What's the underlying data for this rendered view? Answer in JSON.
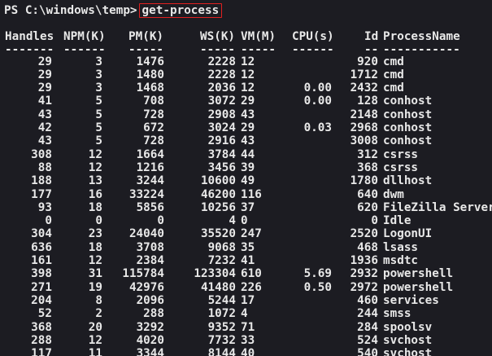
{
  "prompt": {
    "text": "PS C:\\windows\\temp>",
    "command": "get-process"
  },
  "table": {
    "headers": {
      "handles": "Handles",
      "npm": "NPM(K)",
      "pm": "PM(K)",
      "ws": "WS(K)",
      "vm": "VM(M)",
      "cpu": "CPU(s)",
      "id": "Id",
      "name": "ProcessName"
    },
    "underlines": {
      "handles": "-------",
      "npm": "------",
      "pm": "-----",
      "ws": "-----",
      "vm": "-----",
      "cpu": "------",
      "id": "--",
      "name": "-----------"
    },
    "rows": [
      {
        "handles": "29",
        "npm": "3",
        "pm": "1476",
        "ws": "2228",
        "vm": "12",
        "cpu": "",
        "id": "920",
        "name": "cmd"
      },
      {
        "handles": "29",
        "npm": "3",
        "pm": "1480",
        "ws": "2228",
        "vm": "12",
        "cpu": "",
        "id": "1712",
        "name": "cmd"
      },
      {
        "handles": "29",
        "npm": "3",
        "pm": "1468",
        "ws": "2036",
        "vm": "12",
        "cpu": "0.00",
        "id": "2432",
        "name": "cmd"
      },
      {
        "handles": "41",
        "npm": "5",
        "pm": "708",
        "ws": "3072",
        "vm": "29",
        "cpu": "0.00",
        "id": "128",
        "name": "conhost"
      },
      {
        "handles": "43",
        "npm": "5",
        "pm": "728",
        "ws": "2908",
        "vm": "43",
        "cpu": "",
        "id": "2148",
        "name": "conhost"
      },
      {
        "handles": "42",
        "npm": "5",
        "pm": "672",
        "ws": "3024",
        "vm": "29",
        "cpu": "0.03",
        "id": "2968",
        "name": "conhost"
      },
      {
        "handles": "43",
        "npm": "5",
        "pm": "728",
        "ws": "2916",
        "vm": "43",
        "cpu": "",
        "id": "3008",
        "name": "conhost"
      },
      {
        "handles": "308",
        "npm": "12",
        "pm": "1664",
        "ws": "3784",
        "vm": "44",
        "cpu": "",
        "id": "312",
        "name": "csrss"
      },
      {
        "handles": "88",
        "npm": "12",
        "pm": "1216",
        "ws": "3456",
        "vm": "39",
        "cpu": "",
        "id": "368",
        "name": "csrss"
      },
      {
        "handles": "188",
        "npm": "13",
        "pm": "3244",
        "ws": "10600",
        "vm": "49",
        "cpu": "",
        "id": "1780",
        "name": "dllhost"
      },
      {
        "handles": "177",
        "npm": "16",
        "pm": "33224",
        "ws": "46200",
        "vm": "116",
        "cpu": "",
        "id": "640",
        "name": "dwm"
      },
      {
        "handles": "93",
        "npm": "18",
        "pm": "5856",
        "ws": "10256",
        "vm": "37",
        "cpu": "",
        "id": "620",
        "name": "FileZilla Server"
      },
      {
        "handles": "0",
        "npm": "0",
        "pm": "0",
        "ws": "4",
        "vm": "0",
        "cpu": "",
        "id": "0",
        "name": "Idle"
      },
      {
        "handles": "304",
        "npm": "23",
        "pm": "24040",
        "ws": "35520",
        "vm": "247",
        "cpu": "",
        "id": "2520",
        "name": "LogonUI"
      },
      {
        "handles": "636",
        "npm": "18",
        "pm": "3708",
        "ws": "9068",
        "vm": "35",
        "cpu": "",
        "id": "468",
        "name": "lsass"
      },
      {
        "handles": "161",
        "npm": "12",
        "pm": "2384",
        "ws": "7232",
        "vm": "41",
        "cpu": "",
        "id": "1936",
        "name": "msdtc"
      },
      {
        "handles": "398",
        "npm": "31",
        "pm": "115784",
        "ws": "123304",
        "vm": "610",
        "cpu": "5.69",
        "id": "2932",
        "name": "powershell"
      },
      {
        "handles": "271",
        "npm": "19",
        "pm": "42976",
        "ws": "41480",
        "vm": "226",
        "cpu": "0.50",
        "id": "2972",
        "name": "powershell"
      },
      {
        "handles": "204",
        "npm": "8",
        "pm": "2096",
        "ws": "5244",
        "vm": "17",
        "cpu": "",
        "id": "460",
        "name": "services"
      },
      {
        "handles": "52",
        "npm": "2",
        "pm": "288",
        "ws": "1072",
        "vm": "4",
        "cpu": "",
        "id": "244",
        "name": "smss"
      },
      {
        "handles": "368",
        "npm": "20",
        "pm": "3292",
        "ws": "9352",
        "vm": "71",
        "cpu": "",
        "id": "284",
        "name": "spoolsv"
      },
      {
        "handles": "288",
        "npm": "12",
        "pm": "4020",
        "ws": "7732",
        "vm": "33",
        "cpu": "",
        "id": "524",
        "name": "svchost"
      },
      {
        "handles": "117",
        "npm": "11",
        "pm": "3344",
        "ws": "8144",
        "vm": "40",
        "cpu": "",
        "id": "540",
        "name": "svchost"
      }
    ]
  },
  "colors": {
    "background": "#1c1c22",
    "text": "#e8e8e8",
    "highlight_border": "#e02020"
  }
}
